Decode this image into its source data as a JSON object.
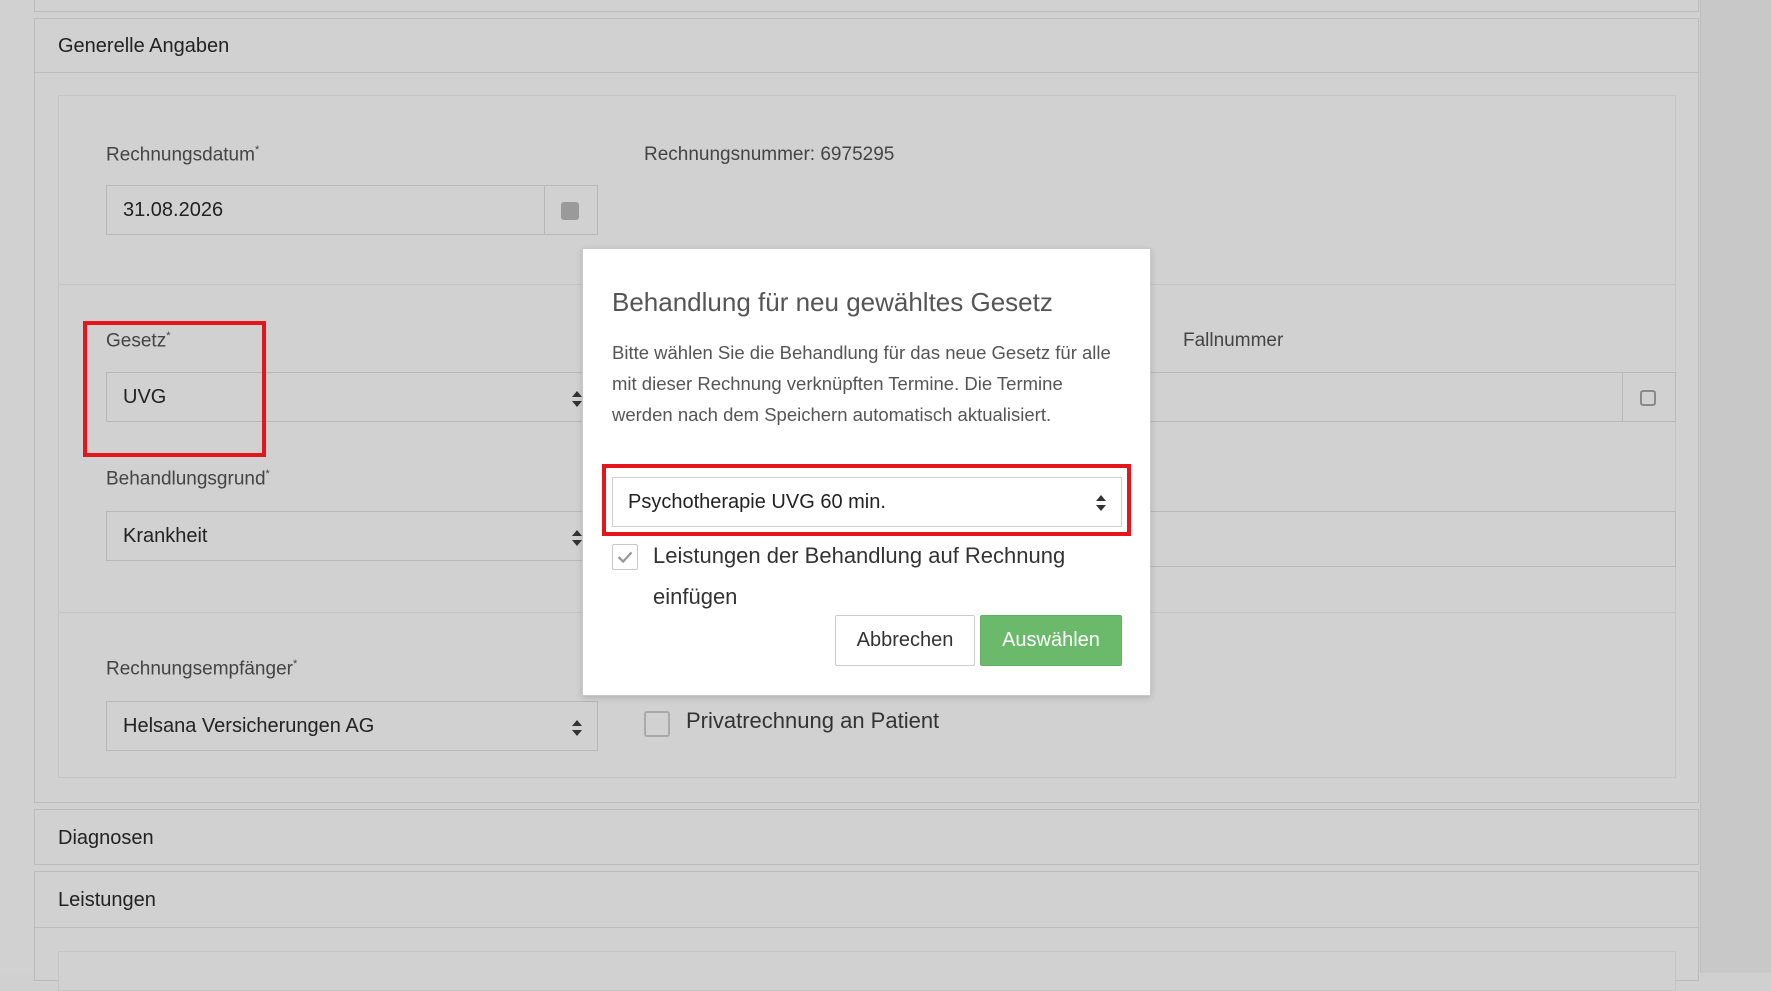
{
  "sections": {
    "general_title": "Generelle Angaben",
    "diagnosen_title": "Diagnosen",
    "leistungen_title": "Leistungen"
  },
  "form": {
    "rechnungsdatum_label": "Rechnungsdatum",
    "rechnungsdatum_value": "31.08.2026",
    "rechnungsnummer_text": "Rechnungsnummer: 6975295",
    "gesetz_label": "Gesetz",
    "gesetz_value": "UVG",
    "fallnummer_label": "Fallnummer",
    "behandlungsgrund_label": "Behandlungsgrund",
    "behandlungsgrund_value": "Krankheit",
    "rechnungsempfaenger_label": "Rechnungsempfänger",
    "rechnungsempfaenger_value": "Helsana Versicherungen AG",
    "privatrechnung_label": "Privatrechnung an Patient",
    "required_marker": "*"
  },
  "modal": {
    "title": "Behandlung für neu gewähltes Gesetz",
    "description": "Bitte wählen Sie die Behandlung für das neue Gesetz für alle mit dieser Rechnung verknüpften Termine. Die Termine werden nach dem Speichern automatisch aktualisiert.",
    "select_value": "Psychotherapie UVG 60 min.",
    "checkbox_label": "Leistungen der Behandlung auf Rechnung einfügen",
    "checkbox_checked": true,
    "cancel_label": "Abbrechen",
    "confirm_label": "Auswählen"
  },
  "colors": {
    "highlight": "#e3161b",
    "confirm_button": "#6bba6b",
    "overlay_bg": "#d1d1d1"
  }
}
